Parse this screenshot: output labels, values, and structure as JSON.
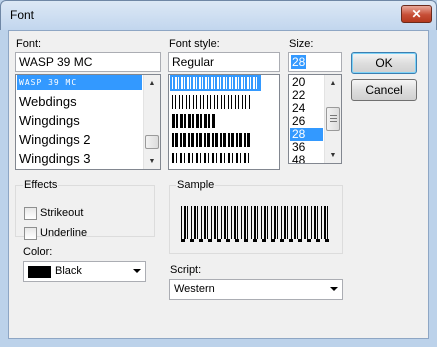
{
  "window": {
    "title": "Font",
    "close_glyph": "✕"
  },
  "font": {
    "label": "Font:",
    "value": "WASP 39 MC",
    "selected_item_text": "WASP 39 MC",
    "items": [
      "Webdings",
      "Wingdings",
      "Wingdings 2",
      "Wingdings 3"
    ]
  },
  "style": {
    "label": "Font style:",
    "value": "Regular"
  },
  "size": {
    "label": "Size:",
    "value": "28",
    "items": [
      "20",
      "22",
      "24",
      "26",
      "28",
      "36",
      "48"
    ],
    "selected": "28"
  },
  "buttons": {
    "ok": "OK",
    "cancel": "Cancel"
  },
  "effects": {
    "label": "Effects",
    "strikeout": "Strikeout",
    "underline": "Underline",
    "strikeout_checked": false,
    "underline_checked": false
  },
  "color": {
    "label": "Color:",
    "value": "Black",
    "swatch": "#000000"
  },
  "sample": {
    "label": "Sample"
  },
  "script": {
    "label": "Script:",
    "value": "Western"
  },
  "colors": {
    "selection": "#3399ff",
    "dialog_bg": "#f0f0f0",
    "frame": "#bcd2ea"
  }
}
